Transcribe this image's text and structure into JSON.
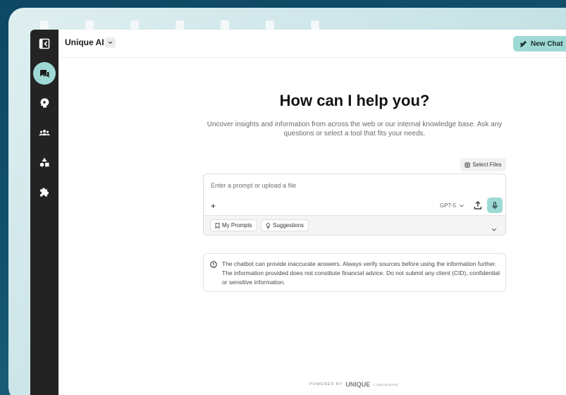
{
  "app": {
    "title": "Unique AI",
    "new_chat_label": "New Chat"
  },
  "sidebar": {
    "items": [
      {
        "icon": "collapse-sidebar-icon"
      },
      {
        "icon": "chat-icon",
        "active": true
      },
      {
        "icon": "brain-icon"
      },
      {
        "icon": "users-icon"
      },
      {
        "icon": "shapes-icon"
      },
      {
        "icon": "puzzle-icon"
      }
    ]
  },
  "main": {
    "heading": "How can I help you?",
    "subheading": "Uncover insights and information from across the web or our internal knowledge base. Ask any questions or select a tool that fits your needs."
  },
  "composer": {
    "select_files_label": "Select Files",
    "placeholder": "Enter a prompt or upload a file",
    "model": "GPT-5",
    "chips": [
      {
        "label": "My Prompts",
        "icon": "bookmark-icon"
      },
      {
        "label": "Suggestions",
        "icon": "lightbulb-icon"
      }
    ]
  },
  "disclaimer": {
    "text": "The chatbot can provide inaccurate answers. Always verify sources before using the information further. The information provided does not constitute financial advice. Do not submit any client (CID), confidential or sensitive information."
  },
  "footer": {
    "powered_by": "POWERED BY",
    "brand": "UNIQUE",
    "version": "v. 2025.29-5(704)"
  },
  "colors": {
    "accent": "#9ed9d5",
    "sidebar": "#232323",
    "background": "#0e4763"
  }
}
